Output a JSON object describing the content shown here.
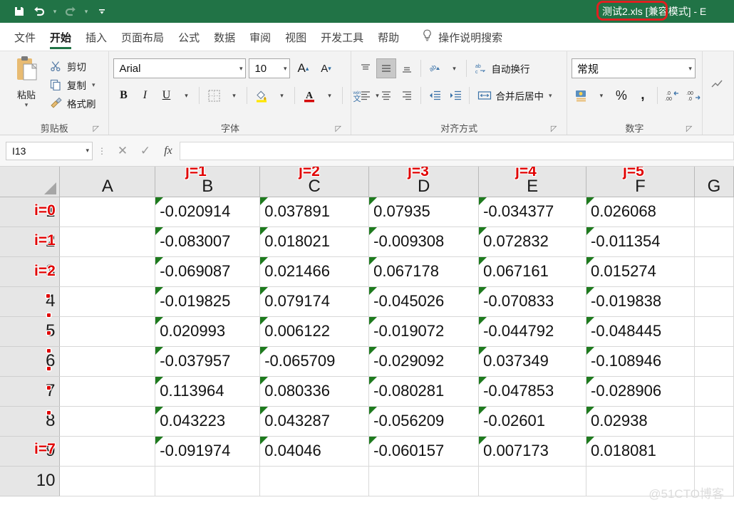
{
  "titlebar": {
    "document_title": "测试2.xls [兼容模式]  -  E",
    "highlight_color": "#e02020",
    "background": "#217346",
    "quick_access": [
      {
        "name": "save-icon",
        "label": "保存"
      },
      {
        "name": "undo-icon",
        "label": "撤销"
      },
      {
        "name": "redo-icon",
        "label": "恢复"
      },
      {
        "name": "customize-qat-icon",
        "label": "自定义快速访问工具栏"
      }
    ]
  },
  "ribbon_tabs": [
    {
      "label": "文件",
      "active": false
    },
    {
      "label": "开始",
      "active": true
    },
    {
      "label": "插入",
      "active": false
    },
    {
      "label": "页面布局",
      "active": false
    },
    {
      "label": "公式",
      "active": false
    },
    {
      "label": "数据",
      "active": false
    },
    {
      "label": "审阅",
      "active": false
    },
    {
      "label": "视图",
      "active": false
    },
    {
      "label": "开发工具",
      "active": false
    },
    {
      "label": "帮助",
      "active": false
    }
  ],
  "tell_me": {
    "label": "操作说明搜索",
    "icon": "lightbulb-icon"
  },
  "ribbon": {
    "clipboard": {
      "group_label": "剪贴板",
      "paste_label": "粘贴",
      "items": [
        {
          "label": "剪切",
          "icon": "scissors-icon"
        },
        {
          "label": "复制",
          "icon": "copy-icon"
        },
        {
          "label": "格式刷",
          "icon": "format-painter-icon"
        }
      ]
    },
    "font": {
      "group_label": "字体",
      "font_name": "Arial",
      "font_size": "10",
      "grow_label": "A",
      "shrink_label": "A",
      "bold_label": "B",
      "italic_label": "I",
      "underline_label": "U",
      "border_icon": "borders-icon",
      "fill_icon": "fill-color-icon",
      "fontcolor_icon": "font-color-icon",
      "phonetic_label": "文"
    },
    "alignment": {
      "group_label": "对齐方式",
      "wrap_text_label": "自动换行",
      "merge_center_label": "合并后居中",
      "orientation_icon": "orientation-icon"
    },
    "number": {
      "group_label": "数字",
      "format_value": "常规",
      "accounting_icon": "accounting-format-icon",
      "percent_label": "%",
      "comma_label": ",",
      "increase_decimal_icon": "increase-decimal-icon",
      "decrease_decimal_icon": "decrease-decimal-icon"
    }
  },
  "formula_bar": {
    "name_box_value": "I13",
    "cancel_icon": "cancel-icon",
    "confirm_icon": "confirm-icon",
    "function_icon": "fx-icon",
    "formula_value": ""
  },
  "grid": {
    "column_headers": [
      "A",
      "B",
      "C",
      "D",
      "E",
      "F",
      "G"
    ],
    "row_headers": [
      "1",
      "2",
      "3",
      "4",
      "5",
      "6",
      "7",
      "8",
      "9",
      "10"
    ],
    "column_annotations": [
      {
        "column": "B",
        "label": "j=1"
      },
      {
        "column": "C",
        "label": "j=2"
      },
      {
        "column": "D",
        "label": "j=3"
      },
      {
        "column": "E",
        "label": "j=4"
      },
      {
        "column": "F",
        "label": "j=5"
      }
    ],
    "row_annotations": [
      {
        "row": "1",
        "label": "i=0"
      },
      {
        "row": "2",
        "label": "i=1"
      },
      {
        "row": "3",
        "label": "i=2"
      },
      {
        "row": "9",
        "label": "i=7"
      }
    ],
    "rows": [
      {
        "header": "1",
        "cells": [
          "",
          "-0.020914",
          "0.037891",
          "0.07935",
          "-0.034377",
          "0.026068",
          ""
        ]
      },
      {
        "header": "2",
        "cells": [
          "",
          "-0.083007",
          "0.018021",
          "-0.009308",
          "0.072832",
          "-0.011354",
          ""
        ]
      },
      {
        "header": "3",
        "cells": [
          "",
          "-0.069087",
          "0.021466",
          "0.067178",
          "0.067161",
          "0.015274",
          ""
        ]
      },
      {
        "header": "4",
        "cells": [
          "",
          "-0.019825",
          "0.079174",
          "-0.045026",
          "-0.070833",
          "-0.019838",
          ""
        ]
      },
      {
        "header": "5",
        "cells": [
          "",
          "0.020993",
          "0.006122",
          "-0.019072",
          "-0.044792",
          "-0.048445",
          ""
        ]
      },
      {
        "header": "6",
        "cells": [
          "",
          "-0.037957",
          "-0.065709",
          "-0.029092",
          "0.037349",
          "-0.108946",
          ""
        ]
      },
      {
        "header": "7",
        "cells": [
          "",
          "0.113964",
          "0.080336",
          "-0.080281",
          "-0.047853",
          "-0.028906",
          ""
        ]
      },
      {
        "header": "8",
        "cells": [
          "",
          "0.043223",
          "0.043287",
          "-0.056209",
          "-0.02601",
          "0.02938",
          ""
        ]
      },
      {
        "header": "9",
        "cells": [
          "",
          "-0.091974",
          "0.04046",
          "-0.060157",
          "0.007173",
          "0.018081",
          ""
        ]
      },
      {
        "header": "10",
        "cells": [
          "",
          "",
          "",
          "",
          "",
          "",
          ""
        ]
      }
    ]
  },
  "watermark": {
    "text": "@51CTO博客"
  }
}
